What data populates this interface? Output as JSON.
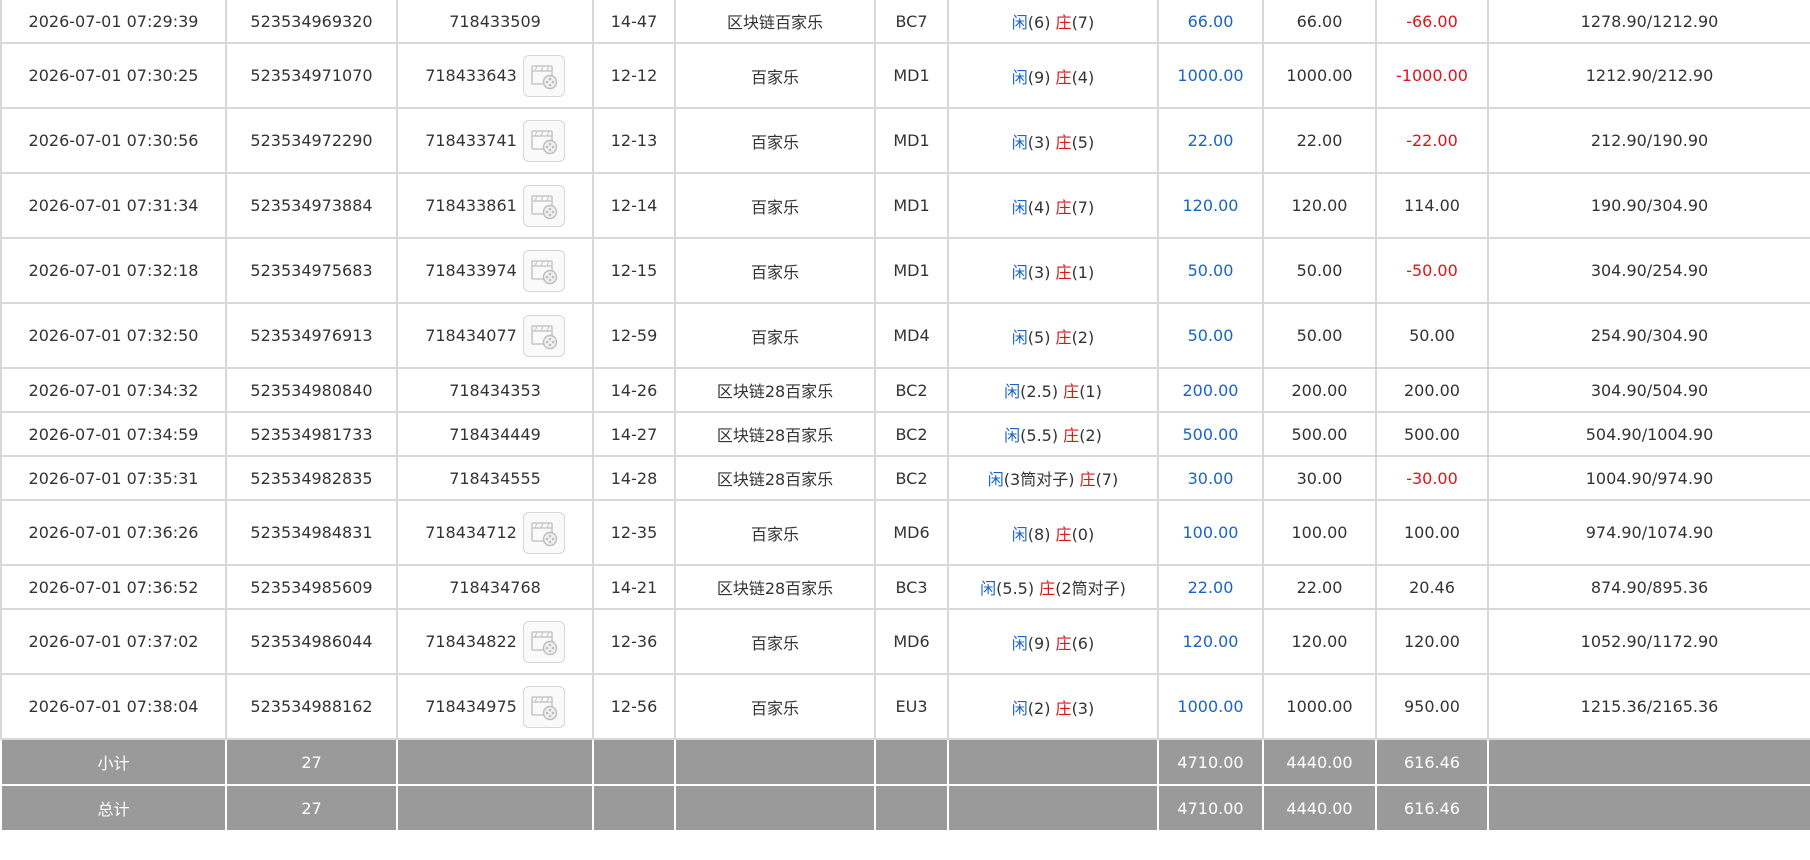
{
  "rows": [
    {
      "time": "2026-07-01 07:29:39",
      "bet_id": "523534969320",
      "round_id": "718433509",
      "has_video": false,
      "seq": "14-47",
      "game": "区块链百家乐",
      "table": "BC7",
      "result": {
        "player_label": "闲",
        "player_val": "(6)",
        "banker_label": "庄",
        "banker_val": "(7)"
      },
      "bet": "66.00",
      "valid": "66.00",
      "win": "-66.00",
      "win_negative": true,
      "balance": "1278.90/1212.90"
    },
    {
      "time": "2026-07-01 07:30:25",
      "bet_id": "523534971070",
      "round_id": "718433643",
      "has_video": true,
      "seq": "12-12",
      "game": "百家乐",
      "table": "MD1",
      "result": {
        "player_label": "闲",
        "player_val": "(9)",
        "banker_label": "庄",
        "banker_val": "(4)"
      },
      "bet": "1000.00",
      "valid": "1000.00",
      "win": "-1000.00",
      "win_negative": true,
      "balance": "1212.90/212.90"
    },
    {
      "time": "2026-07-01 07:30:56",
      "bet_id": "523534972290",
      "round_id": "718433741",
      "has_video": true,
      "seq": "12-13",
      "game": "百家乐",
      "table": "MD1",
      "result": {
        "player_label": "闲",
        "player_val": "(3)",
        "banker_label": "庄",
        "banker_val": "(5)"
      },
      "bet": "22.00",
      "valid": "22.00",
      "win": "-22.00",
      "win_negative": true,
      "balance": "212.90/190.90"
    },
    {
      "time": "2026-07-01 07:31:34",
      "bet_id": "523534973884",
      "round_id": "718433861",
      "has_video": true,
      "seq": "12-14",
      "game": "百家乐",
      "table": "MD1",
      "result": {
        "player_label": "闲",
        "player_val": "(4)",
        "banker_label": "庄",
        "banker_val": "(7)"
      },
      "bet": "120.00",
      "valid": "120.00",
      "win": "114.00",
      "win_negative": false,
      "balance": "190.90/304.90"
    },
    {
      "time": "2026-07-01 07:32:18",
      "bet_id": "523534975683",
      "round_id": "718433974",
      "has_video": true,
      "seq": "12-15",
      "game": "百家乐",
      "table": "MD1",
      "result": {
        "player_label": "闲",
        "player_val": "(3)",
        "banker_label": "庄",
        "banker_val": "(1)"
      },
      "bet": "50.00",
      "valid": "50.00",
      "win": "-50.00",
      "win_negative": true,
      "balance": "304.90/254.90"
    },
    {
      "time": "2026-07-01 07:32:50",
      "bet_id": "523534976913",
      "round_id": "718434077",
      "has_video": true,
      "seq": "12-59",
      "game": "百家乐",
      "table": "MD4",
      "result": {
        "player_label": "闲",
        "player_val": "(5)",
        "banker_label": "庄",
        "banker_val": "(2)"
      },
      "bet": "50.00",
      "valid": "50.00",
      "win": "50.00",
      "win_negative": false,
      "balance": "254.90/304.90"
    },
    {
      "time": "2026-07-01 07:34:32",
      "bet_id": "523534980840",
      "round_id": "718434353",
      "has_video": false,
      "seq": "14-26",
      "game": "区块链28百家乐",
      "table": "BC2",
      "result": {
        "player_label": "闲",
        "player_val": "(2.5)",
        "banker_label": "庄",
        "banker_val": "(1)"
      },
      "bet": "200.00",
      "valid": "200.00",
      "win": "200.00",
      "win_negative": false,
      "balance": "304.90/504.90"
    },
    {
      "time": "2026-07-01 07:34:59",
      "bet_id": "523534981733",
      "round_id": "718434449",
      "has_video": false,
      "seq": "14-27",
      "game": "区块链28百家乐",
      "table": "BC2",
      "result": {
        "player_label": "闲",
        "player_val": "(5.5)",
        "banker_label": "庄",
        "banker_val": "(2)"
      },
      "bet": "500.00",
      "valid": "500.00",
      "win": "500.00",
      "win_negative": false,
      "balance": "504.90/1004.90"
    },
    {
      "time": "2026-07-01 07:35:31",
      "bet_id": "523534982835",
      "round_id": "718434555",
      "has_video": false,
      "seq": "14-28",
      "game": "区块链28百家乐",
      "table": "BC2",
      "result": {
        "player_label": "闲",
        "player_val": "(3筒对子)",
        "banker_label": "庄",
        "banker_val": "(7)"
      },
      "bet": "30.00",
      "valid": "30.00",
      "win": "-30.00",
      "win_negative": true,
      "balance": "1004.90/974.90"
    },
    {
      "time": "2026-07-01 07:36:26",
      "bet_id": "523534984831",
      "round_id": "718434712",
      "has_video": true,
      "seq": "12-35",
      "game": "百家乐",
      "table": "MD6",
      "result": {
        "player_label": "闲",
        "player_val": "(8)",
        "banker_label": "庄",
        "banker_val": "(0)"
      },
      "bet": "100.00",
      "valid": "100.00",
      "win": "100.00",
      "win_negative": false,
      "balance": "974.90/1074.90"
    },
    {
      "time": "2026-07-01 07:36:52",
      "bet_id": "523534985609",
      "round_id": "718434768",
      "has_video": false,
      "seq": "14-21",
      "game": "区块链28百家乐",
      "table": "BC3",
      "result": {
        "player_label": "闲",
        "player_val": "(5.5)",
        "banker_label": "庄",
        "banker_val": "(2筒对子)"
      },
      "bet": "22.00",
      "valid": "22.00",
      "win": "20.46",
      "win_negative": false,
      "balance": "874.90/895.36"
    },
    {
      "time": "2026-07-01 07:37:02",
      "bet_id": "523534986044",
      "round_id": "718434822",
      "has_video": true,
      "seq": "12-36",
      "game": "百家乐",
      "table": "MD6",
      "result": {
        "player_label": "闲",
        "player_val": "(9)",
        "banker_label": "庄",
        "banker_val": "(6)"
      },
      "bet": "120.00",
      "valid": "120.00",
      "win": "120.00",
      "win_negative": false,
      "balance": "1052.90/1172.90"
    },
    {
      "time": "2026-07-01 07:38:04",
      "bet_id": "523534988162",
      "round_id": "718434975",
      "has_video": true,
      "seq": "12-56",
      "game": "百家乐",
      "table": "EU3",
      "result": {
        "player_label": "闲",
        "player_val": "(2)",
        "banker_label": "庄",
        "banker_val": "(3)"
      },
      "bet": "1000.00",
      "valid": "1000.00",
      "win": "950.00",
      "win_negative": false,
      "balance": "1215.36/2165.36"
    }
  ],
  "subtotal": {
    "label": "小计",
    "count": "27",
    "bet": "4710.00",
    "valid": "4440.00",
    "win": "616.46"
  },
  "total": {
    "label": "总计",
    "count": "27",
    "bet": "4710.00",
    "valid": "4440.00",
    "win": "616.46"
  },
  "colors": {
    "blue": "#1a63c8",
    "red": "#e0131b",
    "footer_bg": "#9a9a9a"
  },
  "icons": {
    "video": "video-replay-icon"
  }
}
